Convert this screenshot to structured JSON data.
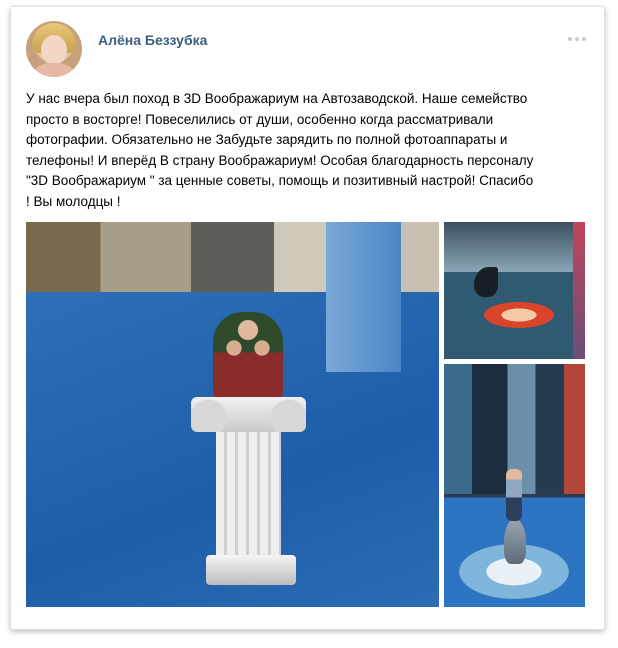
{
  "post": {
    "author": "Алёна Беззубка",
    "text": "У нас вчера был поход в 3D Воображариум на Автозаводской. Наше семейство\nпросто в восторге! Повеселились от души, особенно когда рассматривали\nфотографии. Обязательно не Забудьте зарядить по полной фотоаппараты и\nтелефоны! И вперёд В страну Воображариум! Особая благодарность персоналу\n\"3D Воображариум \" за ценные советы, помощь и позитивный настрой! Спасибо\n! Вы молодцы !"
  },
  "icons": {
    "menu": "more-dots-icon"
  },
  "colors": {
    "author_link": "#3b5d82",
    "card_border": "#dfe2e8"
  }
}
